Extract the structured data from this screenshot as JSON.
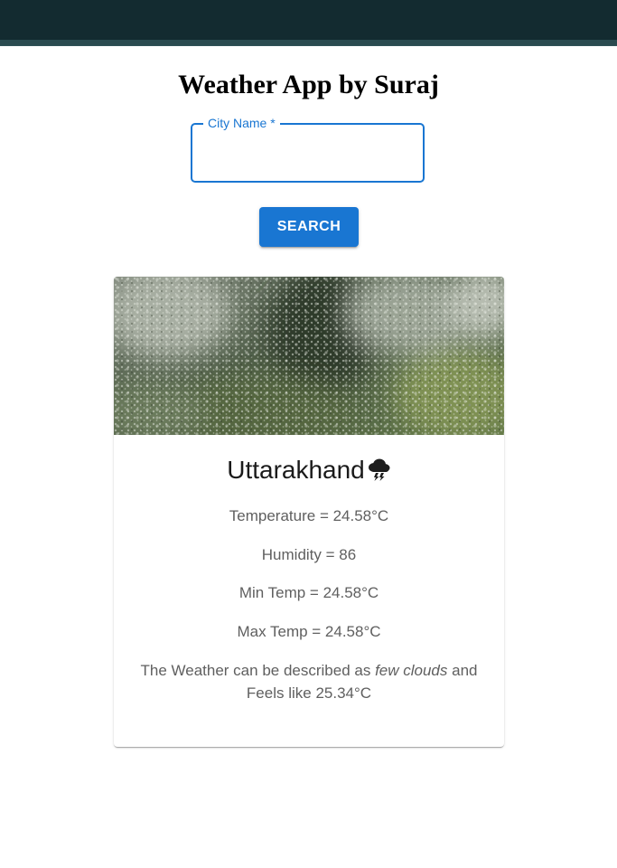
{
  "app": {
    "title": "Weather App by Suraj"
  },
  "search": {
    "label": "City Name *",
    "value": "",
    "button_label": "SEARCH"
  },
  "weather_card": {
    "city": "Uttarakhand",
    "weather_icon": "thunderstorm-cloud-icon",
    "temperature": "Temperature = 24.58°C",
    "humidity": "Humidity = 86",
    "min_temp": "Min Temp = 24.58°C",
    "max_temp": "Max Temp = 24.58°C",
    "description_prefix": "The Weather can be described as ",
    "description_condition": "few clouds",
    "description_suffix": " and Feels like 25.34°C"
  },
  "colors": {
    "accent": "#1976d2",
    "topbar": "#132b30"
  }
}
